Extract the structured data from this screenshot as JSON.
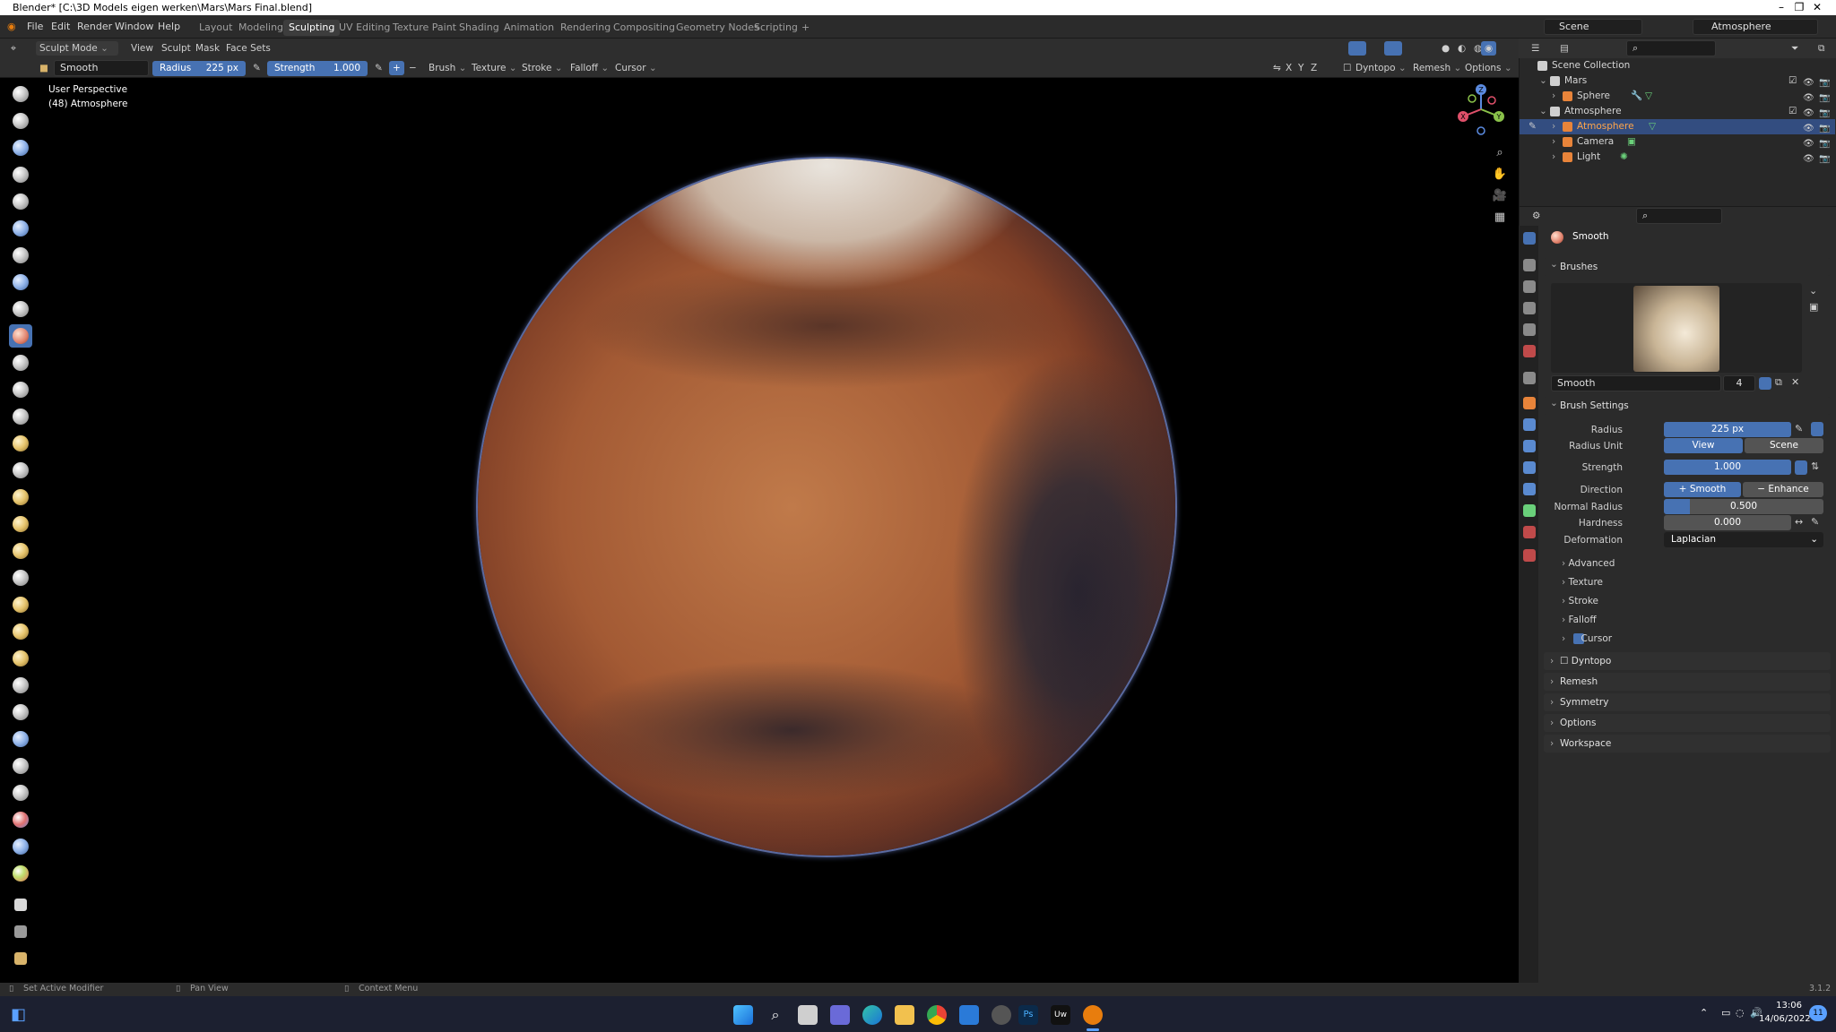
{
  "window": {
    "title": "Blender* [C:\\3D Models eigen werken\\Mars\\Mars Final.blend]",
    "controls": [
      "–",
      "❐",
      "✕"
    ]
  },
  "menubar": [
    "File",
    "Edit",
    "Render",
    "Window",
    "Help"
  ],
  "workspaces": [
    "Layout",
    "Modeling",
    "Sculpting",
    "UV Editing",
    "Texture Paint",
    "Shading",
    "Animation",
    "Rendering",
    "Compositing",
    "Geometry Nodes",
    "Scripting",
    "+"
  ],
  "active_workspace": "Sculpting",
  "scene": {
    "label": "Scene",
    "view_layer": "Atmosphere"
  },
  "header1": {
    "mode": "Sculpt Mode",
    "menus": [
      "View",
      "Sculpt",
      "Mask",
      "Face Sets"
    ]
  },
  "header2": {
    "brush_name": "Smooth",
    "radius_label": "Radius",
    "radius_value": "225 px",
    "strength_label": "Strength",
    "strength_value": "1.000",
    "menus": [
      "Brush",
      "Texture",
      "Stroke",
      "Falloff",
      "Cursor"
    ],
    "axes": [
      "X",
      "Y",
      "Z"
    ],
    "right_menus": [
      "Dyntopo",
      "Remesh",
      "Options"
    ]
  },
  "viewport": {
    "perspective": "User Perspective",
    "object": "(48) Atmosphere",
    "gizmo_axes": [
      "Z",
      "X",
      "Y"
    ]
  },
  "outliner": {
    "root": "Scene Collection",
    "rows": [
      {
        "name": "Mars",
        "type": "collection"
      },
      {
        "name": "Sphere",
        "type": "mesh"
      },
      {
        "name": "Atmosphere",
        "type": "collection"
      },
      {
        "name": "Atmosphere",
        "type": "mesh",
        "selected": true
      },
      {
        "name": "Camera",
        "type": "camera"
      },
      {
        "name": "Light",
        "type": "light"
      }
    ]
  },
  "properties": {
    "tool_name": "Smooth",
    "brushes_label": "Brushes",
    "brush_slot_name": "Smooth",
    "brush_users": "4",
    "brush_settings_label": "Brush Settings",
    "radius_label": "Radius",
    "radius_value": "225 px",
    "radius_unit_label": "Radius Unit",
    "radius_unit_options": [
      "View",
      "Scene"
    ],
    "strength_label": "Strength",
    "strength_value": "1.000",
    "direction_label": "Direction",
    "direction_options": [
      "Smooth",
      "Enhance Details"
    ],
    "normal_radius_label": "Normal Radius",
    "normal_radius_value": "0.500",
    "normal_radius_fraction": 0.5,
    "hardness_label": "Hardness",
    "hardness_value": "0.000",
    "deformation_label": "Deformation",
    "deformation_value": "Laplacian",
    "subsections": [
      "Advanced",
      "Texture",
      "Stroke",
      "Falloff",
      "Cursor"
    ],
    "sections": [
      "Dyntopo",
      "Remesh",
      "Symmetry",
      "Options",
      "Workspace"
    ]
  },
  "statusbar": {
    "left": "Set Active Modifier",
    "middle": "Pan View",
    "right_hint": "Context Menu",
    "version": "3.1.2"
  },
  "taskbar": {
    "time": "13:06",
    "date": "14/06/2022",
    "notification_count": "11"
  },
  "colors": {
    "accent": "#4772b3",
    "selection": "#334d80",
    "mars": "#a35a34",
    "background": "#000000"
  }
}
